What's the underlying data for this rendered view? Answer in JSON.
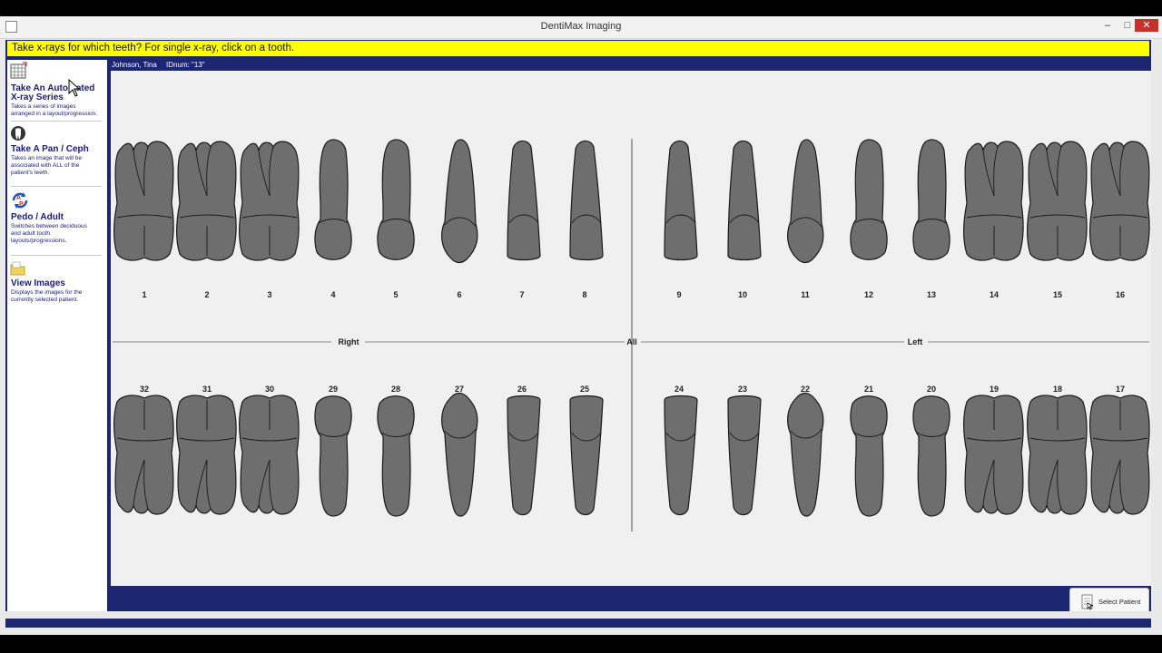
{
  "window": {
    "title": "DentiMax Imaging",
    "min": "–",
    "max": "□",
    "close": "✕"
  },
  "prompt": {
    "text": "Take x-rays for which teeth?  For single x-ray, click on a tooth."
  },
  "sidebar": {
    "items": [
      {
        "label1": "Take An Automated",
        "label2": "X-ray Series",
        "desc": [
          "Takes a series of images",
          "arranged in a layout/progression."
        ],
        "icon": "grid-icon"
      },
      {
        "label1": "Take A Pan / Ceph",
        "label2": "",
        "desc": [
          "Takes an image that will be",
          "associated with ALL of the",
          "patient's teeth."
        ],
        "icon": "tooth-icon"
      },
      {
        "label1": "Pedo / Adult",
        "label2": "",
        "desc": [
          "Switches between deciduous",
          "and adult tooth",
          "layouts/progressions."
        ],
        "icon": "swap-icon"
      },
      {
        "label1": "View Images",
        "label2": "",
        "desc": [
          "Displays the images for the",
          "currently selected patient."
        ],
        "icon": "folder-icon"
      }
    ]
  },
  "patient": {
    "name": "Johnson, Tina",
    "id_label": "IDnum: \"13\""
  },
  "chart": {
    "side_right": "Right",
    "side_all": "All",
    "side_left": "Left",
    "upper_numbers": [
      "1",
      "2",
      "3",
      "4",
      "5",
      "6",
      "7",
      "8",
      "9",
      "10",
      "11",
      "12",
      "13",
      "14",
      "15",
      "16"
    ],
    "lower_numbers": [
      "32",
      "31",
      "30",
      "29",
      "28",
      "27",
      "26",
      "25",
      "24",
      "23",
      "22",
      "21",
      "20",
      "19",
      "18",
      "17"
    ],
    "upper_types": [
      "molar",
      "molar",
      "molar",
      "premolar",
      "premolar",
      "canine",
      "incisor",
      "incisor",
      "incisor",
      "incisor",
      "canine",
      "premolar",
      "premolar",
      "molar",
      "molar",
      "molar"
    ],
    "lower_types": [
      "molar",
      "molar",
      "molar",
      "premolar",
      "premolar",
      "canine",
      "incisor",
      "incisor",
      "incisor",
      "incisor",
      "canine",
      "premolar",
      "premolar",
      "molar",
      "molar",
      "molar"
    ],
    "tooth_color": "#6e6e6e"
  },
  "footer": {
    "select_patient": "Select Patient"
  }
}
